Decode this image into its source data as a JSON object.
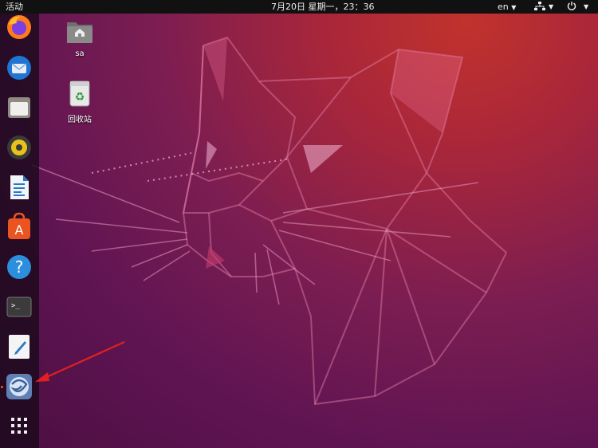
{
  "topbar": {
    "activities": "活动",
    "clock": "7月20日 星期一，23：36",
    "input_method": "en",
    "network_icon": "network-icon",
    "power_icon": "power-icon"
  },
  "dock": {
    "items": [
      {
        "name": "firefox",
        "icon": "firefox-icon"
      },
      {
        "name": "thunderbird",
        "icon": "thunderbird-icon"
      },
      {
        "name": "files",
        "icon": "files-icon"
      },
      {
        "name": "rhythmbox",
        "icon": "rhythmbox-icon"
      },
      {
        "name": "libreoffice-writer",
        "icon": "writer-icon"
      },
      {
        "name": "ubuntu-software",
        "icon": "software-icon"
      },
      {
        "name": "help",
        "icon": "help-icon"
      },
      {
        "name": "terminal",
        "icon": "terminal-icon"
      },
      {
        "name": "text-editor",
        "icon": "text-editor-icon"
      },
      {
        "name": "running-app",
        "icon": "app-icon"
      },
      {
        "name": "show-applications",
        "icon": "grid-icon"
      }
    ]
  },
  "desktop": {
    "icons": [
      {
        "label": "sa",
        "icon": "home-folder-icon"
      },
      {
        "label": "回收站",
        "icon": "trash-icon"
      }
    ]
  },
  "colors": {
    "topbar": "#111111",
    "dock": "#1c0a1c",
    "wallpaper_top": "#c1322c",
    "wallpaper_bottom": "#4b0f41",
    "annotation": "#e02020"
  }
}
